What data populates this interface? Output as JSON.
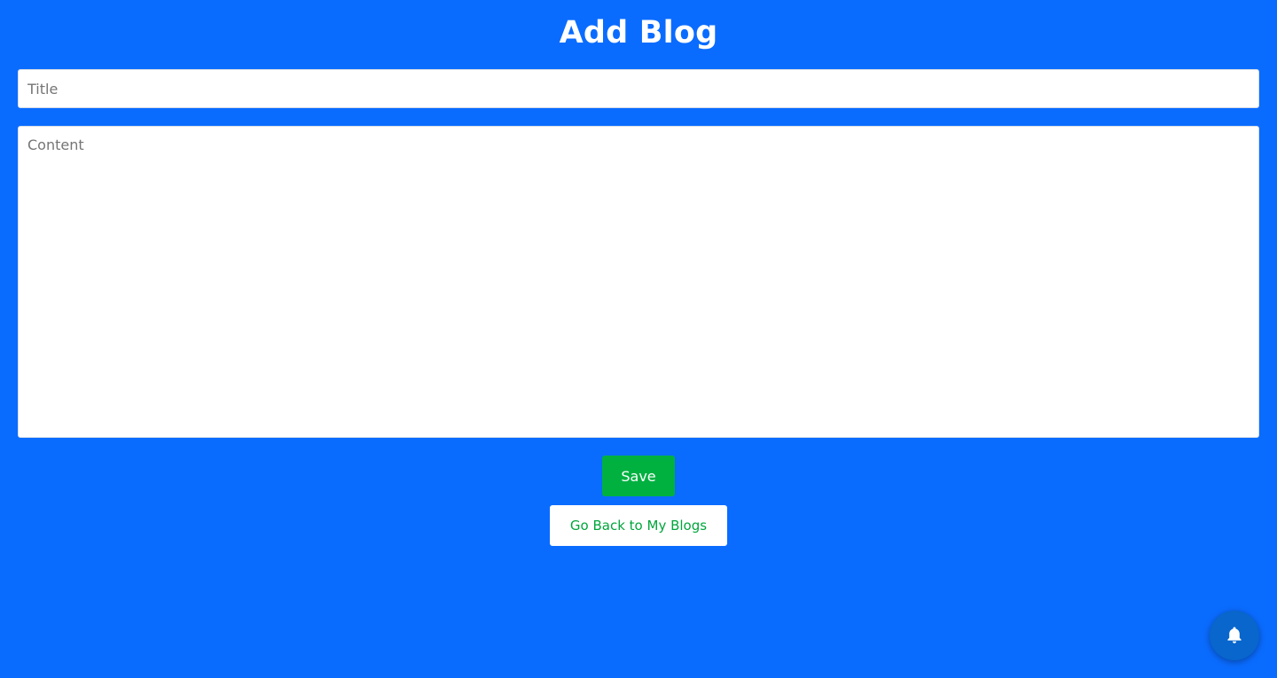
{
  "page": {
    "title": "Add Blog"
  },
  "form": {
    "title_placeholder": "Title",
    "title_value": "",
    "content_placeholder": "Content",
    "content_value": "",
    "save_label": "Save",
    "back_label": "Go Back to My Blogs"
  },
  "notification": {
    "icon": "bell-icon"
  },
  "colors": {
    "background": "#0a6cff",
    "save_button": "#00b140",
    "back_button_text": "#00a53c",
    "notify_button": "#0866cc"
  }
}
